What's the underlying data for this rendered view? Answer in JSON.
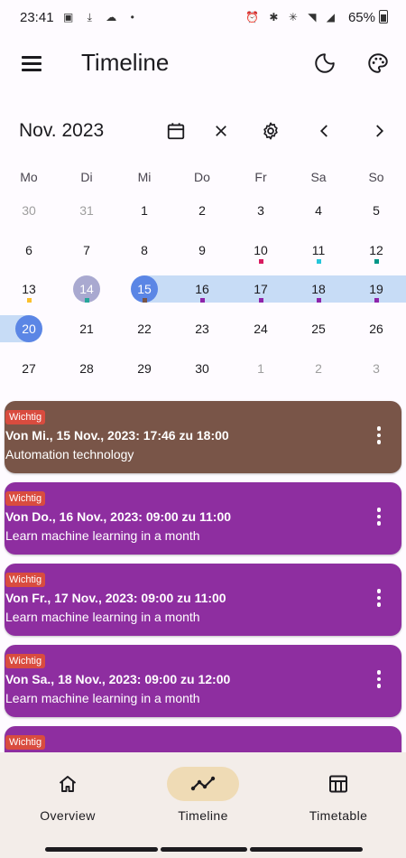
{
  "status_bar": {
    "time": "23:41",
    "battery": "65%"
  },
  "app_bar": {
    "title": "Timeline"
  },
  "calendar": {
    "month_label": "Nov. 2023",
    "weekdays": [
      "Mo",
      "Di",
      "Mi",
      "Do",
      "Fr",
      "Sa",
      "So"
    ],
    "weeks": [
      [
        "30",
        "31",
        "1",
        "2",
        "3",
        "4",
        "5"
      ],
      [
        "6",
        "7",
        "8",
        "9",
        "10",
        "11",
        "12"
      ],
      [
        "13",
        "14",
        "15",
        "16",
        "17",
        "18",
        "19"
      ],
      [
        "20",
        "21",
        "22",
        "23",
        "24",
        "25",
        "26"
      ],
      [
        "27",
        "28",
        "29",
        "30",
        "1",
        "2",
        "3"
      ]
    ],
    "today": "14",
    "selected_start": "15",
    "selected_end": "20",
    "colors": {
      "today": "#a9a9d0",
      "selected": "#5b86e5",
      "range": "#c7dcf6"
    },
    "event_dots": [
      {
        "day": "10",
        "color": "#d81b60"
      },
      {
        "day": "11",
        "color": "#26c6da"
      },
      {
        "day": "12",
        "color": "#009688"
      },
      {
        "day": "13",
        "color": "#fbc02d"
      },
      {
        "day": "14",
        "color": "#26a69a"
      },
      {
        "day": "15",
        "color": "#795548"
      },
      {
        "day": "16",
        "color": "#8e24aa"
      },
      {
        "day": "17",
        "color": "#8e24aa"
      },
      {
        "day": "18",
        "color": "#8e24aa"
      },
      {
        "day": "19",
        "color": "#8e24aa"
      }
    ]
  },
  "events": [
    {
      "badge": "Wichtig",
      "title": "Von Mi., 15 Nov., 2023: 17:46 zu 18:00",
      "subtitle": "Automation technology",
      "color": "#795548"
    },
    {
      "badge": "Wichtig",
      "title": "Von Do., 16 Nov., 2023: 09:00 zu 11:00",
      "subtitle": "Learn machine learning in a month",
      "color": "#8e2ea0"
    },
    {
      "badge": "Wichtig",
      "title": "Von Fr., 17 Nov., 2023: 09:00 zu 11:00",
      "subtitle": "Learn machine learning in a month",
      "color": "#8e2ea0"
    },
    {
      "badge": "Wichtig",
      "title": "Von Sa., 18 Nov., 2023: 09:00 zu 12:00",
      "subtitle": "Learn machine learning in a month",
      "color": "#8e2ea0"
    },
    {
      "badge": "Wichtig",
      "title": "",
      "subtitle": "",
      "color": "#8e2ea0"
    }
  ],
  "bottom_nav": {
    "items": [
      {
        "label": "Overview",
        "icon": "home-icon"
      },
      {
        "label": "Timeline",
        "icon": "timeline-icon"
      },
      {
        "label": "Timetable",
        "icon": "table-icon"
      }
    ],
    "active": "Timeline",
    "active_color": "#efdbb5"
  }
}
